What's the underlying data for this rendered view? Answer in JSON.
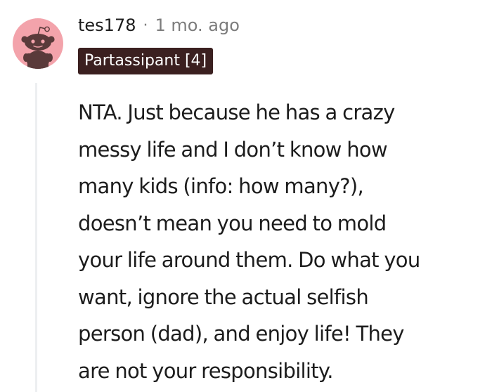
{
  "comment": {
    "author": "tes178",
    "separator": "·",
    "timestamp": "1 mo. ago",
    "flair": "Partassipant [4]",
    "avatar_icon": "reddit-snoo-avatar-icon",
    "avatar_color": "#f3a3ab",
    "flair_color": "#3b2020",
    "body_lines": [
      "NTA. Just because he has a crazy",
      "messy life and I don’t know how",
      "many kids (info: how many?),",
      "doesn’t mean you need to mold",
      "your life around them. Do what you",
      "want, ignore the actual selfish",
      "person (dad), and enjoy life! They",
      "are not your responsibility."
    ]
  }
}
